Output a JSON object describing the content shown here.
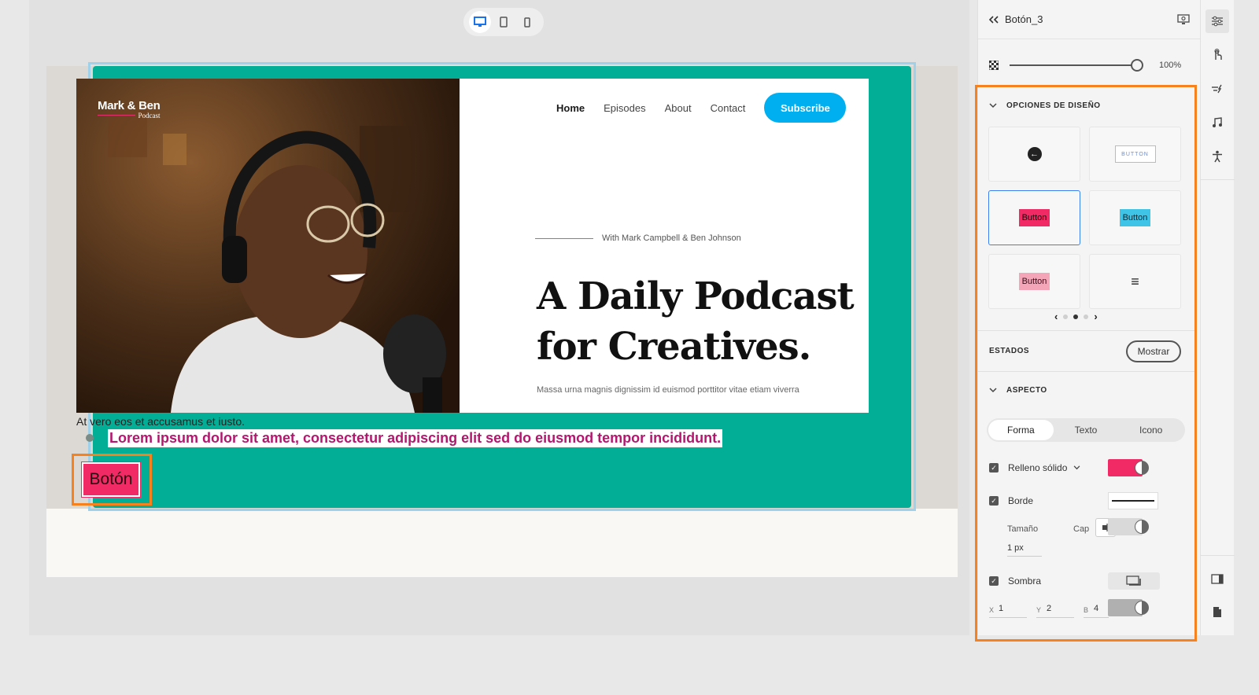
{
  "app": {
    "element_title": "Botón_3"
  },
  "device_toolbar": {
    "items": [
      {
        "name": "desktop-icon",
        "active": true
      },
      {
        "name": "tablet-icon",
        "active": false
      },
      {
        "name": "phone-icon",
        "active": false
      }
    ]
  },
  "canvas": {
    "brand": {
      "name": "Mark & Ben",
      "sub": "Podcast"
    },
    "nav": {
      "links": [
        "Home",
        "Episodes",
        "About",
        "Contact"
      ],
      "subscribe": "Subscribe"
    },
    "with_text": "With Mark Campbell & Ben Johnson",
    "headline": "A Daily Podcast for Creatives.",
    "lead": "Massa urna magnis dignissim id euismod porttitor vitae etiam viverra",
    "text_line1": "At vero eos et accusamus et iusto.",
    "text_line2": "Lorem ipsum dolor sit amet, consectetur adipiscing elit sed do eiusmod tempor incididunt.",
    "button_label": "Botón",
    "colors": {
      "teal": "#03ae96",
      "button_fill": "#f12a65",
      "subscribe": "#00aff0",
      "highlight": "#f6811d"
    }
  },
  "panel": {
    "opacity": "100%",
    "opacity_value": 1.0,
    "design_options": {
      "title": "OPCIONES DE DISEÑO",
      "presets": [
        {
          "kind": "circle-arrow",
          "label": ""
        },
        {
          "kind": "outline",
          "label": "BUTTON"
        },
        {
          "kind": "red",
          "label": "Button",
          "selected": true
        },
        {
          "kind": "blue",
          "label": "Button"
        },
        {
          "kind": "pink",
          "label": "Button"
        },
        {
          "kind": "menu",
          "label": "≡"
        }
      ],
      "pager": {
        "pages": 3,
        "current": 2
      }
    },
    "states": {
      "title": "ESTADOS",
      "show_button": "Mostrar"
    },
    "appearance": {
      "title": "ASPECTO",
      "tabs": [
        "Forma",
        "Texto",
        "Icono"
      ],
      "active_tab": "Forma",
      "fill": {
        "label": "Relleno sólido",
        "checked": true,
        "color": "#f12a65"
      },
      "border": {
        "label": "Borde",
        "checked": true,
        "size_label": "Tamaño",
        "size_value": "1 px",
        "cap_label": "Cap",
        "color": "#d9d9d9"
      },
      "shadow": {
        "label": "Sombra",
        "checked": true,
        "x_label": "X",
        "x": "1",
        "y_label": "Y",
        "y": "2",
        "b_label": "B",
        "b": "4",
        "color": "#b0b0b0"
      }
    }
  },
  "rail": {
    "icons": [
      "properties-icon",
      "interaction-icon",
      "animation-icon",
      "audio-icon",
      "accessibility-icon",
      "layout-panel-icon",
      "page-icon"
    ]
  }
}
